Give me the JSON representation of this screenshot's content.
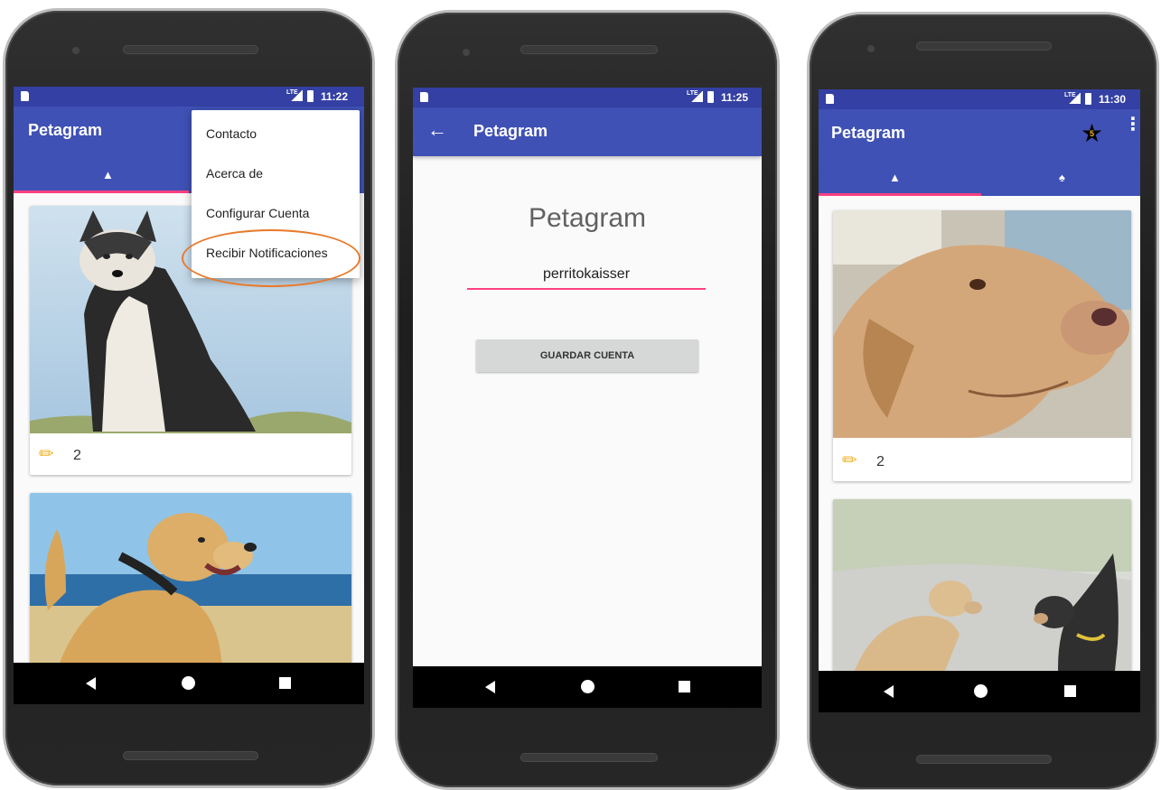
{
  "colors": {
    "primary": "#3f51b5",
    "primary_dark": "#3440a3",
    "accent": "#ff4081",
    "highlight_circle": "#e8792a"
  },
  "phone1": {
    "status_time": "11:22",
    "app_title": "Petagram",
    "menu_items": [
      "Contacto",
      "Acerca de",
      "Configurar Cuenta",
      "Recibir Notificaciones"
    ],
    "cards": [
      {
        "likes": "2"
      }
    ]
  },
  "phone2": {
    "status_time": "11:25",
    "app_title": "Petagram",
    "heading": "Petagram",
    "account_value": "perritokaisser",
    "save_button": "GUARDAR CUENTA"
  },
  "phone3": {
    "status_time": "11:30",
    "app_title": "Petagram",
    "star_badge": "5",
    "cards": [
      {
        "likes": "2"
      }
    ]
  }
}
